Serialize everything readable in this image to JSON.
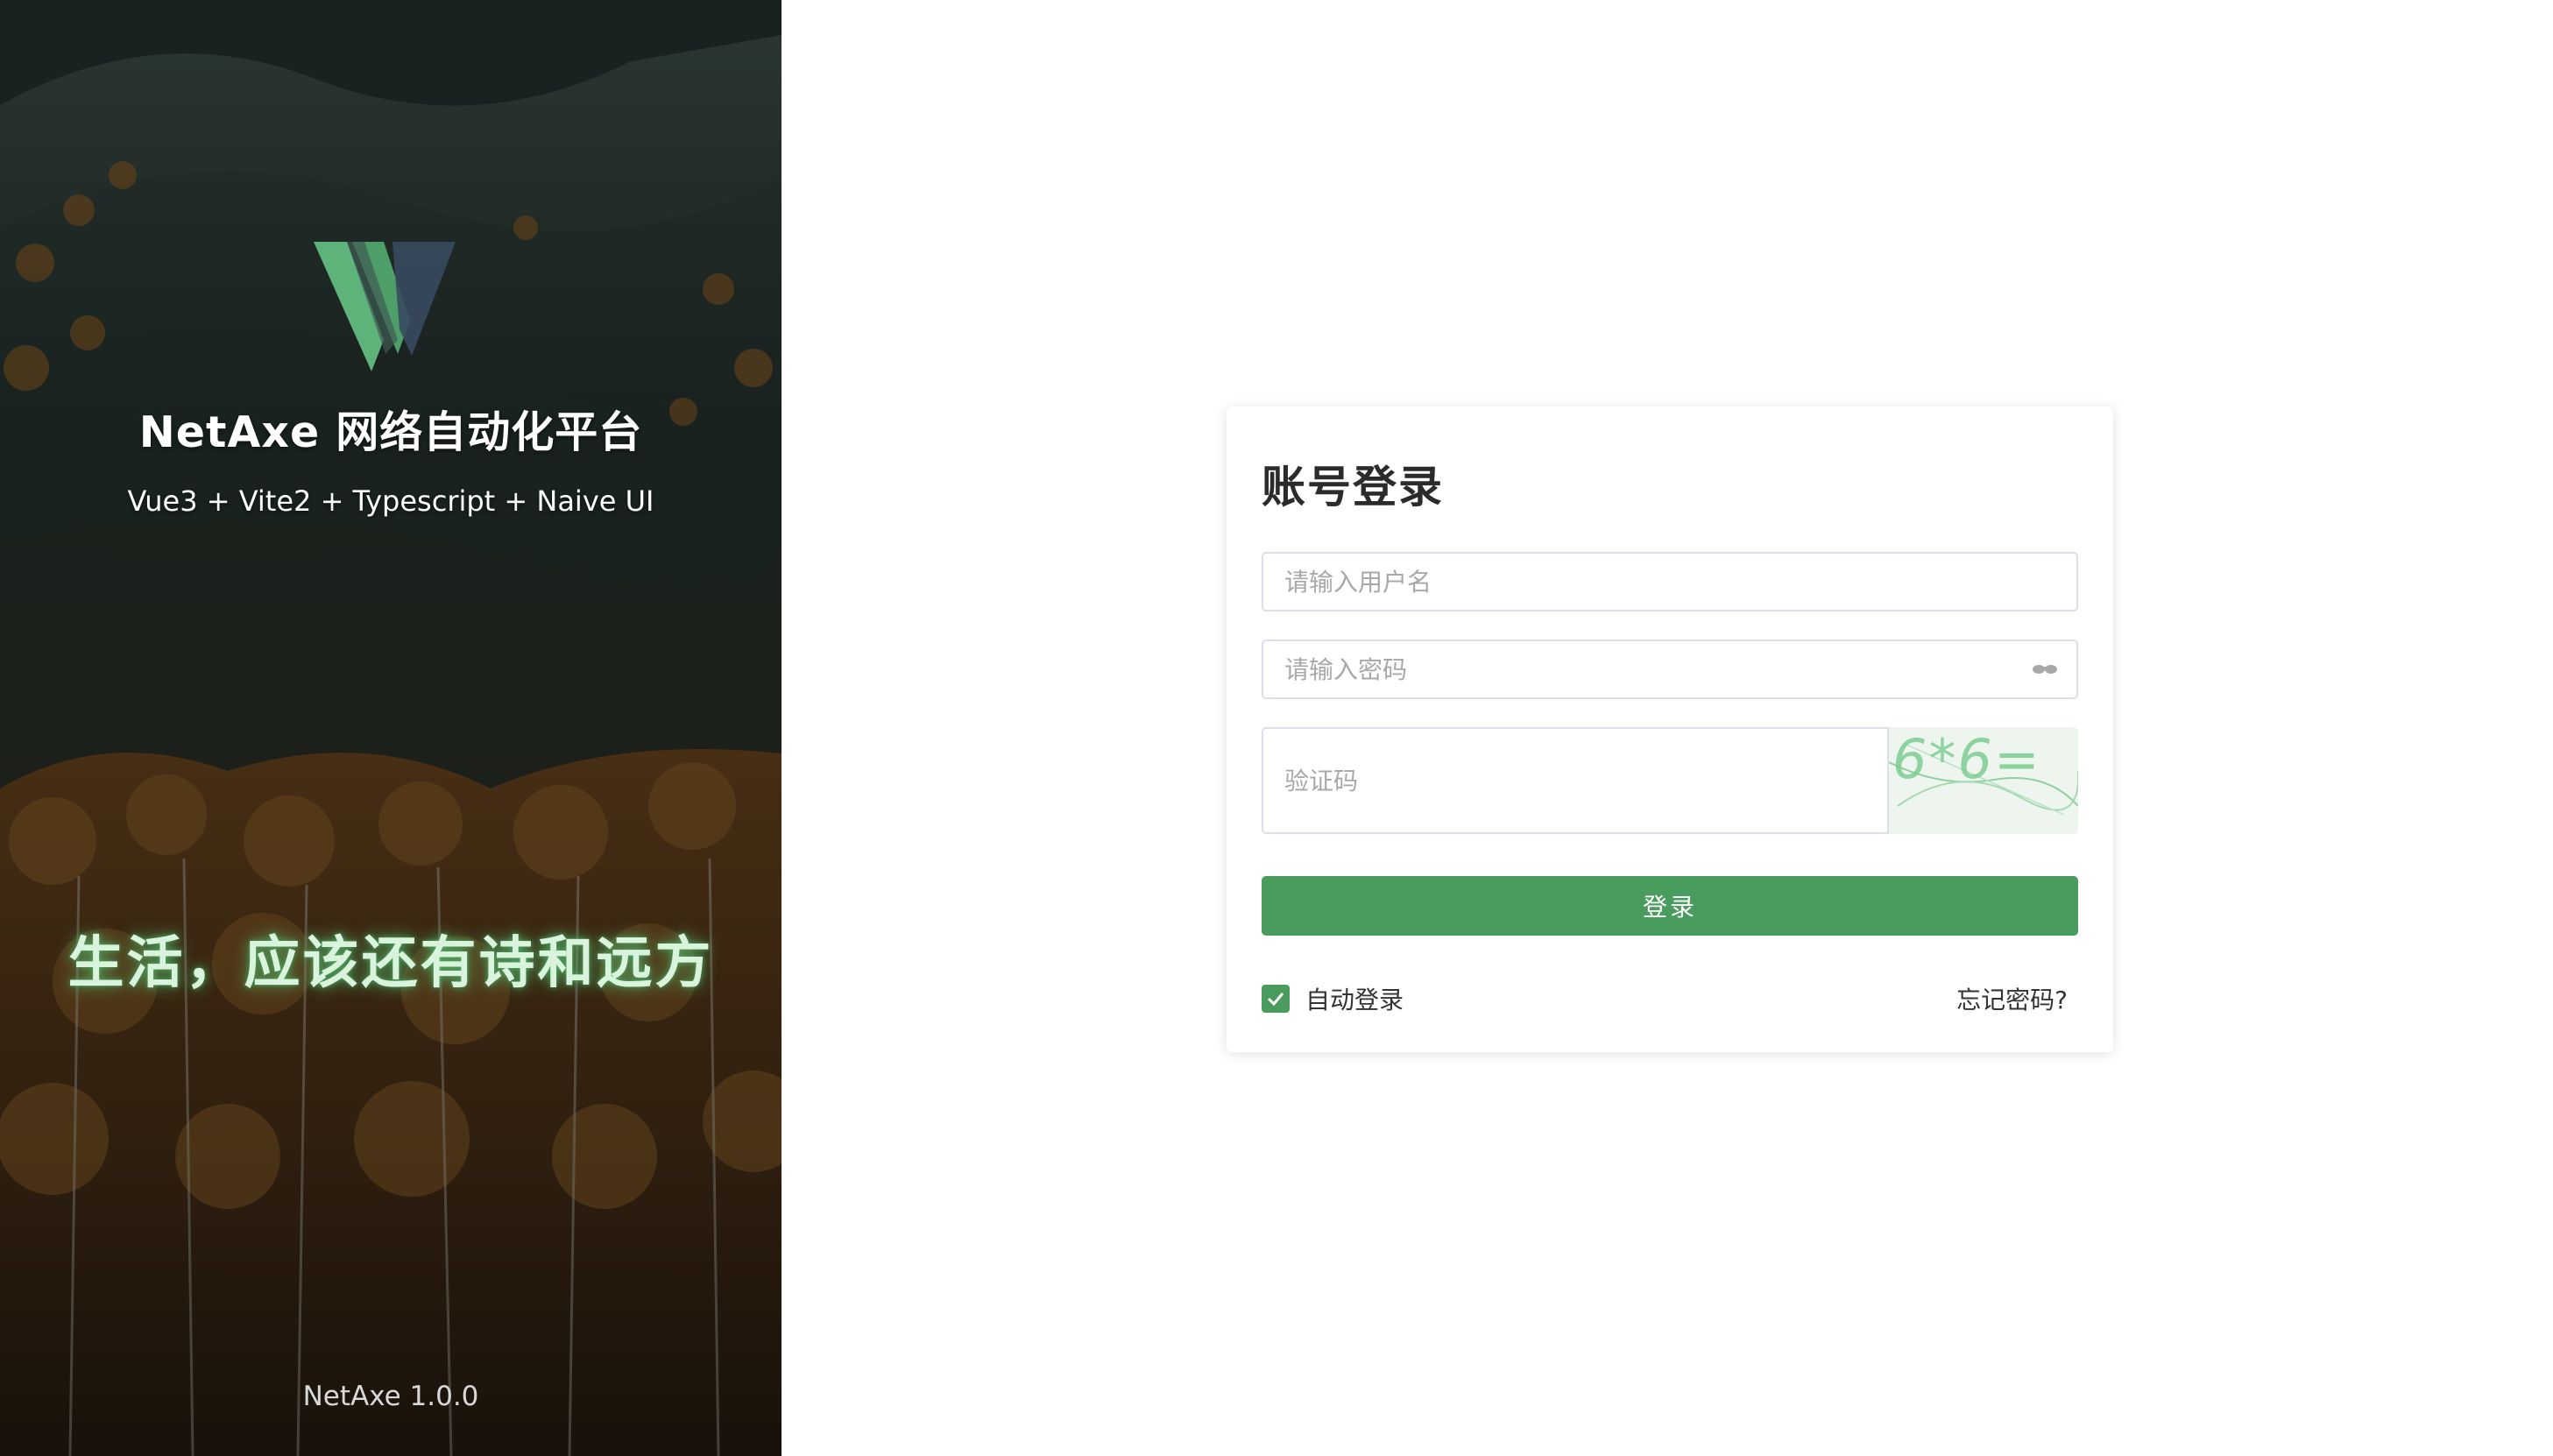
{
  "brand": {
    "title": "NetAxe 网络自动化平台",
    "subtitle": "Vue3 + Vite2 + Typescript + Naive UI",
    "slogan": "生活，应该还有诗和远方",
    "version": "NetAxe 1.0.0",
    "logo_icon": "netaxe-w-logo-icon"
  },
  "login": {
    "title": "账号登录",
    "username_placeholder": "请输入用户名",
    "password_placeholder": "请输入密码",
    "captcha_placeholder": "验证码",
    "captcha_text": "6*6=",
    "submit_label": "登录",
    "auto_login_label": "自动登录",
    "auto_login_checked": true,
    "forgot_password_label": "忘记密码?"
  },
  "colors": {
    "accent": "#4a9c5e",
    "slogan_glow": "#5ac878"
  }
}
